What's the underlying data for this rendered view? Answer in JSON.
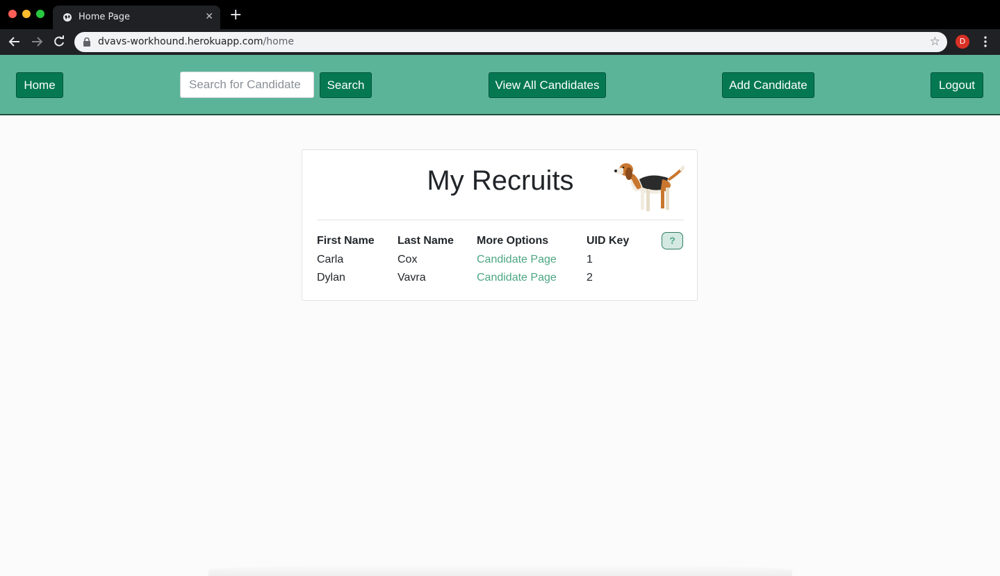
{
  "browser": {
    "tab_title": "Home Page",
    "tab_close": "✕",
    "new_tab": "+",
    "url_host": "dvavs-workhound.herokuapp.com",
    "url_path": "/home",
    "profile_initial": "D"
  },
  "nav": {
    "home_label": "Home",
    "search_placeholder": "Search for Candidate",
    "search_label": "Search",
    "view_all_label": "View All Candidates",
    "add_label": "Add Candidate",
    "logout_label": "Logout"
  },
  "card": {
    "title": "My Recruits",
    "help_label": "?",
    "columns": [
      "First Name",
      "Last Name",
      "More Options",
      "UID Key"
    ],
    "rows": [
      {
        "first": "Carla",
        "last": "Cox",
        "option": "Candidate Page",
        "uid": "1"
      },
      {
        "first": "Dylan",
        "last": "Vavra",
        "option": "Candidate Page",
        "uid": "2"
      }
    ]
  },
  "colors": {
    "navbar": "#5bb498",
    "button": "#057852",
    "link": "#4ca683"
  }
}
